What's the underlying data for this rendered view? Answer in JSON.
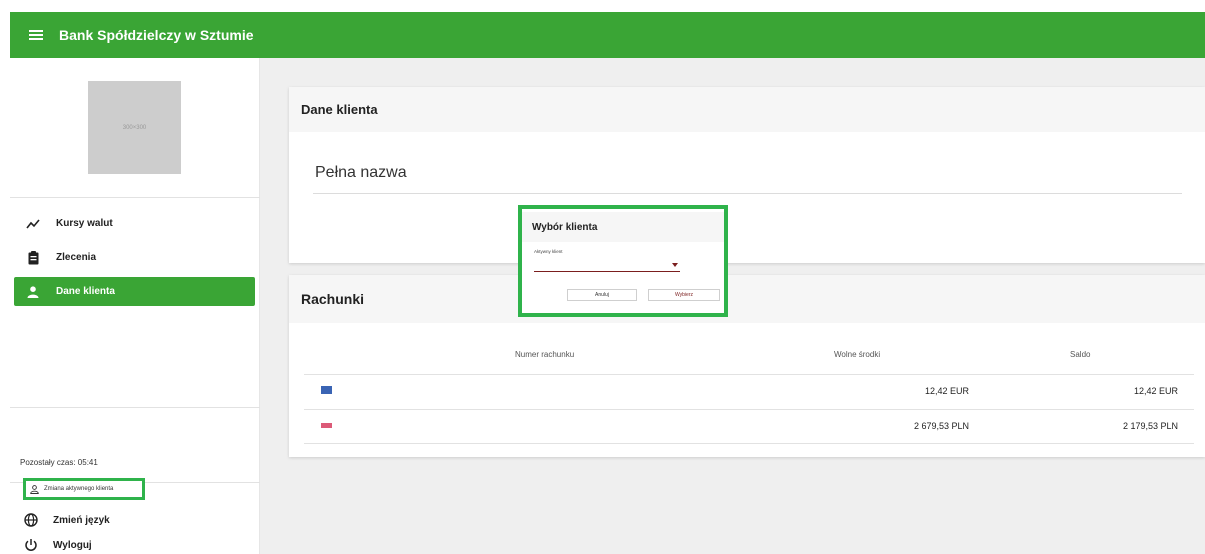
{
  "header": {
    "title": "Bank Spółdzielczy w Sztumie"
  },
  "sidebar": {
    "logo_placeholder": "300×300",
    "nav": [
      {
        "label": "Kursy walut",
        "icon": "trending-up-icon"
      },
      {
        "label": "Zlecenia",
        "icon": "clipboard-icon"
      },
      {
        "label": "Dane klienta",
        "icon": "person-icon",
        "active": true
      }
    ],
    "remaining_time": "Pozostały czas: 05:41",
    "change_client": "Zmiana aktywnego klienta",
    "language": "Zmień język",
    "logout": "Wyloguj"
  },
  "client_card": {
    "title": "Dane klienta",
    "full_name_label": "Pełna nazwa"
  },
  "accounts_card": {
    "title": "Rachunki",
    "columns": [
      "Numer rachunku",
      "Wolne środki",
      "Saldo"
    ],
    "rows": [
      {
        "flag": "EU",
        "flag_color": "#3a64b4",
        "available": "12,42 EUR",
        "balance": "12,42 EUR"
      },
      {
        "flag": "PL",
        "flag_color": "#dc143c",
        "available": "2 679,53 PLN",
        "balance": "2 179,53 PLN"
      }
    ]
  },
  "dialog": {
    "title": "Wybór klienta",
    "field_label": "Aktywny klient",
    "cancel": "Anuluj",
    "confirm": "Wybierz"
  },
  "colors": {
    "brand": "#3aa535",
    "highlight": "#2fb34b",
    "accent": "#7b1e1e"
  }
}
